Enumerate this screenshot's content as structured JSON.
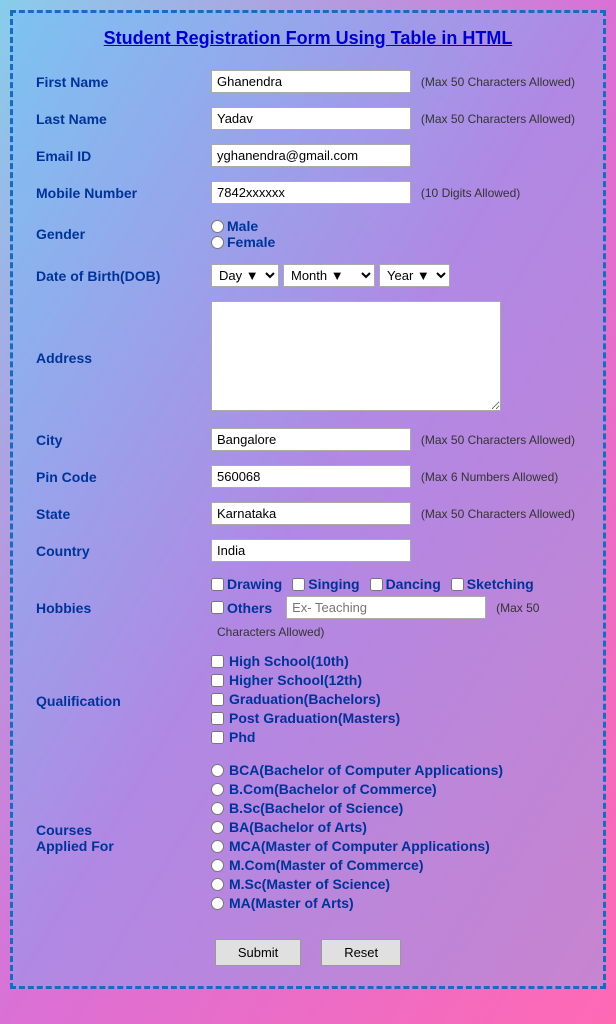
{
  "page": {
    "title": "Student Registration Form Using Table in HTML"
  },
  "form": {
    "first_name": {
      "label": "First Name",
      "value": "Ghanendra",
      "hint": "(Max 50 Characters Allowed)"
    },
    "last_name": {
      "label": "Last Name",
      "value": "Yadav",
      "hint": "(Max 50 Characters Allowed)"
    },
    "email": {
      "label": "Email ID",
      "value": "yghanendra@gmail.com"
    },
    "mobile": {
      "label": "Mobile Number",
      "value": "7842xxxxxx",
      "hint": "(10 Digits Allowed)"
    },
    "gender": {
      "label": "Gender",
      "options": [
        "Male",
        "Female"
      ]
    },
    "dob": {
      "label": "Date of Birth(DOB)",
      "day_label": "Day",
      "month_label": "Month",
      "year_label": "Year"
    },
    "address": {
      "label": "Address"
    },
    "city": {
      "label": "City",
      "value": "Bangalore",
      "hint": "(Max 50 Characters Allowed)"
    },
    "pincode": {
      "label": "Pin Code",
      "value": "560068",
      "hint": "(Max 6 Numbers Allowed)"
    },
    "state": {
      "label": "State",
      "value": "Karnataka",
      "hint": "(Max 50 Characters Allowed)"
    },
    "country": {
      "label": "Country",
      "value": "India"
    },
    "hobbies": {
      "label": "Hobbies",
      "options": [
        "Drawing",
        "Singing",
        "Dancing",
        "Sketching"
      ],
      "others_label": "Others",
      "others_placeholder": "Ex- Teaching",
      "others_hint": "(Max 50 Characters Allowed)"
    },
    "qualification": {
      "label": "Qualification",
      "options": [
        "High School(10th)",
        "Higher School(12th)",
        "Graduation(Bachelors)",
        "Post Graduation(Masters)",
        "Phd"
      ]
    },
    "courses": {
      "label": "Courses Applied For",
      "options": [
        "BCA(Bachelor of Computer Applications)",
        "B.Com(Bachelor of Commerce)",
        "B.Sc(Bachelor of Science)",
        "BA(Bachelor of Arts)",
        "MCA(Master of Computer Applications)",
        "M.Com(Master of Commerce)",
        "M.Sc(Master of Science)",
        "MA(Master of Arts)"
      ]
    },
    "buttons": {
      "submit": "Submit",
      "reset": "Reset"
    }
  }
}
